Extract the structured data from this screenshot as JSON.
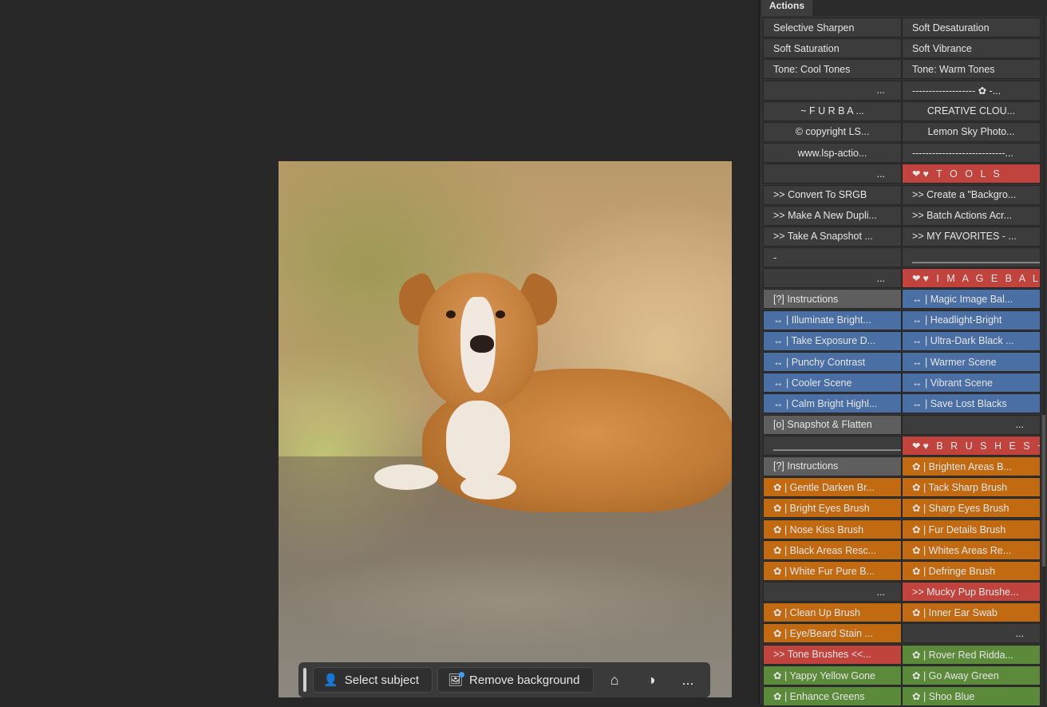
{
  "panel": {
    "title": "Actions"
  },
  "taskbar": {
    "select_subject": "Select subject",
    "remove_background": "Remove background",
    "more": "..."
  },
  "actions": [
    [
      {
        "t": "Selective Sharpen",
        "c": "none"
      },
      {
        "t": "Soft Desaturation",
        "c": "none"
      }
    ],
    [
      {
        "t": "Soft Saturation",
        "c": "none"
      },
      {
        "t": "Soft Vibrance",
        "c": "none"
      }
    ],
    [
      {
        "t": "Tone: Cool Tones",
        "c": "none"
      },
      {
        "t": "Tone: Warm Tones",
        "c": "none"
      }
    ],
    [
      {
        "t": "...",
        "c": "none",
        "a": "r"
      },
      {
        "t": "-------------------   ✿   -...",
        "c": "none"
      }
    ],
    [
      {
        "t": "~  F U R   B A ...",
        "c": "none",
        "a": "c"
      },
      {
        "t": "CREATIVE CLOU...",
        "c": "none",
        "a": "c"
      }
    ],
    [
      {
        "t": "© copyright LS...",
        "c": "none",
        "a": "c"
      },
      {
        "t": "Lemon Sky Photo...",
        "c": "none",
        "a": "c"
      }
    ],
    [
      {
        "t": "www.lsp-actio...",
        "c": "none",
        "a": "c"
      },
      {
        "t": "----------------------------...",
        "c": "none"
      }
    ],
    [
      {
        "t": "...",
        "c": "none",
        "a": "r"
      },
      {
        "t": "❤♥  T O O L S",
        "c": "red",
        "sp": true
      }
    ],
    [
      {
        "t": ">> Convert To SRGB",
        "c": "none"
      },
      {
        "t": ">> Create a \"Backgro...",
        "c": "none"
      }
    ],
    [
      {
        "t": ">> Make A New Dupli...",
        "c": "none"
      },
      {
        "t": ">> Batch Actions Acr...",
        "c": "none"
      }
    ],
    [
      {
        "t": ">> Take A Snapshot ...",
        "c": "none"
      },
      {
        "t": ">> MY FAVORITES - ...",
        "c": "none"
      }
    ],
    [
      {
        "t": "-",
        "c": "none"
      },
      {
        "t": "________________________...",
        "c": "none"
      }
    ],
    [
      {
        "t": "...",
        "c": "none",
        "a": "r"
      },
      {
        "t": "❤♥  I M A G E  B A L ...",
        "c": "red",
        "sp": true
      }
    ],
    [
      {
        "t": "[?]   Instructions",
        "c": "gray"
      },
      {
        "t": "↔  |   Magic Image Bal...",
        "c": "blue"
      }
    ],
    [
      {
        "t": "↔  |   Illuminate Bright...",
        "c": "blue"
      },
      {
        "t": "↔  |   Headlight-Bright",
        "c": "blue"
      }
    ],
    [
      {
        "t": "↔  |   Take Exposure D...",
        "c": "blue"
      },
      {
        "t": "↔  |   Ultra-Dark Black ...",
        "c": "blue"
      }
    ],
    [
      {
        "t": "↔  |   Punchy Contrast",
        "c": "blue"
      },
      {
        "t": "↔  |   Warmer Scene",
        "c": "blue"
      }
    ],
    [
      {
        "t": "↔  |   Cooler Scene",
        "c": "blue"
      },
      {
        "t": "↔  |   Vibrant Scene",
        "c": "blue"
      }
    ],
    [
      {
        "t": "↔  |   Calm Bright Highl...",
        "c": "blue"
      },
      {
        "t": "↔  |   Save Lost Blacks",
        "c": "blue"
      }
    ],
    [
      {
        "t": "[o] Snapshot & Flatten",
        "c": "gray"
      },
      {
        "t": "...",
        "c": "dark",
        "a": "r"
      }
    ],
    [
      {
        "t": "________________________...",
        "c": "none"
      },
      {
        "t": "❤♥  B R U S H E S  ~...",
        "c": "red",
        "sp": true
      }
    ],
    [
      {
        "t": "[?]   Instructions",
        "c": "gray"
      },
      {
        "t": "✿  |   Brighten Areas B...",
        "c": "orange"
      }
    ],
    [
      {
        "t": "✿  |   Gentle Darken Br...",
        "c": "orange"
      },
      {
        "t": "✿  |   Tack Sharp Brush",
        "c": "orange"
      }
    ],
    [
      {
        "t": "✿  |   Bright Eyes Brush",
        "c": "orange"
      },
      {
        "t": "✿  |   Sharp Eyes Brush",
        "c": "orange"
      }
    ],
    [
      {
        "t": "✿  |   Nose Kiss Brush",
        "c": "orange"
      },
      {
        "t": "✿  |   Fur Details Brush",
        "c": "orange"
      }
    ],
    [
      {
        "t": "✿  |   Black Areas Resc...",
        "c": "orange"
      },
      {
        "t": "✿  |   Whites Areas Re...",
        "c": "orange"
      }
    ],
    [
      {
        "t": "✿  |   White Fur Pure B...",
        "c": "orange"
      },
      {
        "t": "✿  |   Defringe Brush",
        "c": "orange"
      }
    ],
    [
      {
        "t": "...",
        "c": "none",
        "a": "r"
      },
      {
        "t": ">> Mucky Pup Brushe...",
        "c": "red"
      }
    ],
    [
      {
        "t": "✿  |   Clean Up Brush",
        "c": "orange"
      },
      {
        "t": "✿  |   Inner Ear Swab",
        "c": "orange"
      }
    ],
    [
      {
        "t": "✿  |   Eye/Beard Stain ...",
        "c": "orange"
      },
      {
        "t": "...",
        "c": "dark",
        "a": "r"
      }
    ],
    [
      {
        "t": ">> Tone Brushes <<...",
        "c": "red"
      },
      {
        "t": "✿  |   Rover Red Ridda...",
        "c": "green"
      }
    ],
    [
      {
        "t": "✿  |   Yappy Yellow Gone",
        "c": "green"
      },
      {
        "t": "✿  |   Go Away Green",
        "c": "green"
      }
    ],
    [
      {
        "t": "✿  |   Enhance Greens",
        "c": "green"
      },
      {
        "t": "✿  |   Shoo Blue",
        "c": "green"
      }
    ]
  ]
}
